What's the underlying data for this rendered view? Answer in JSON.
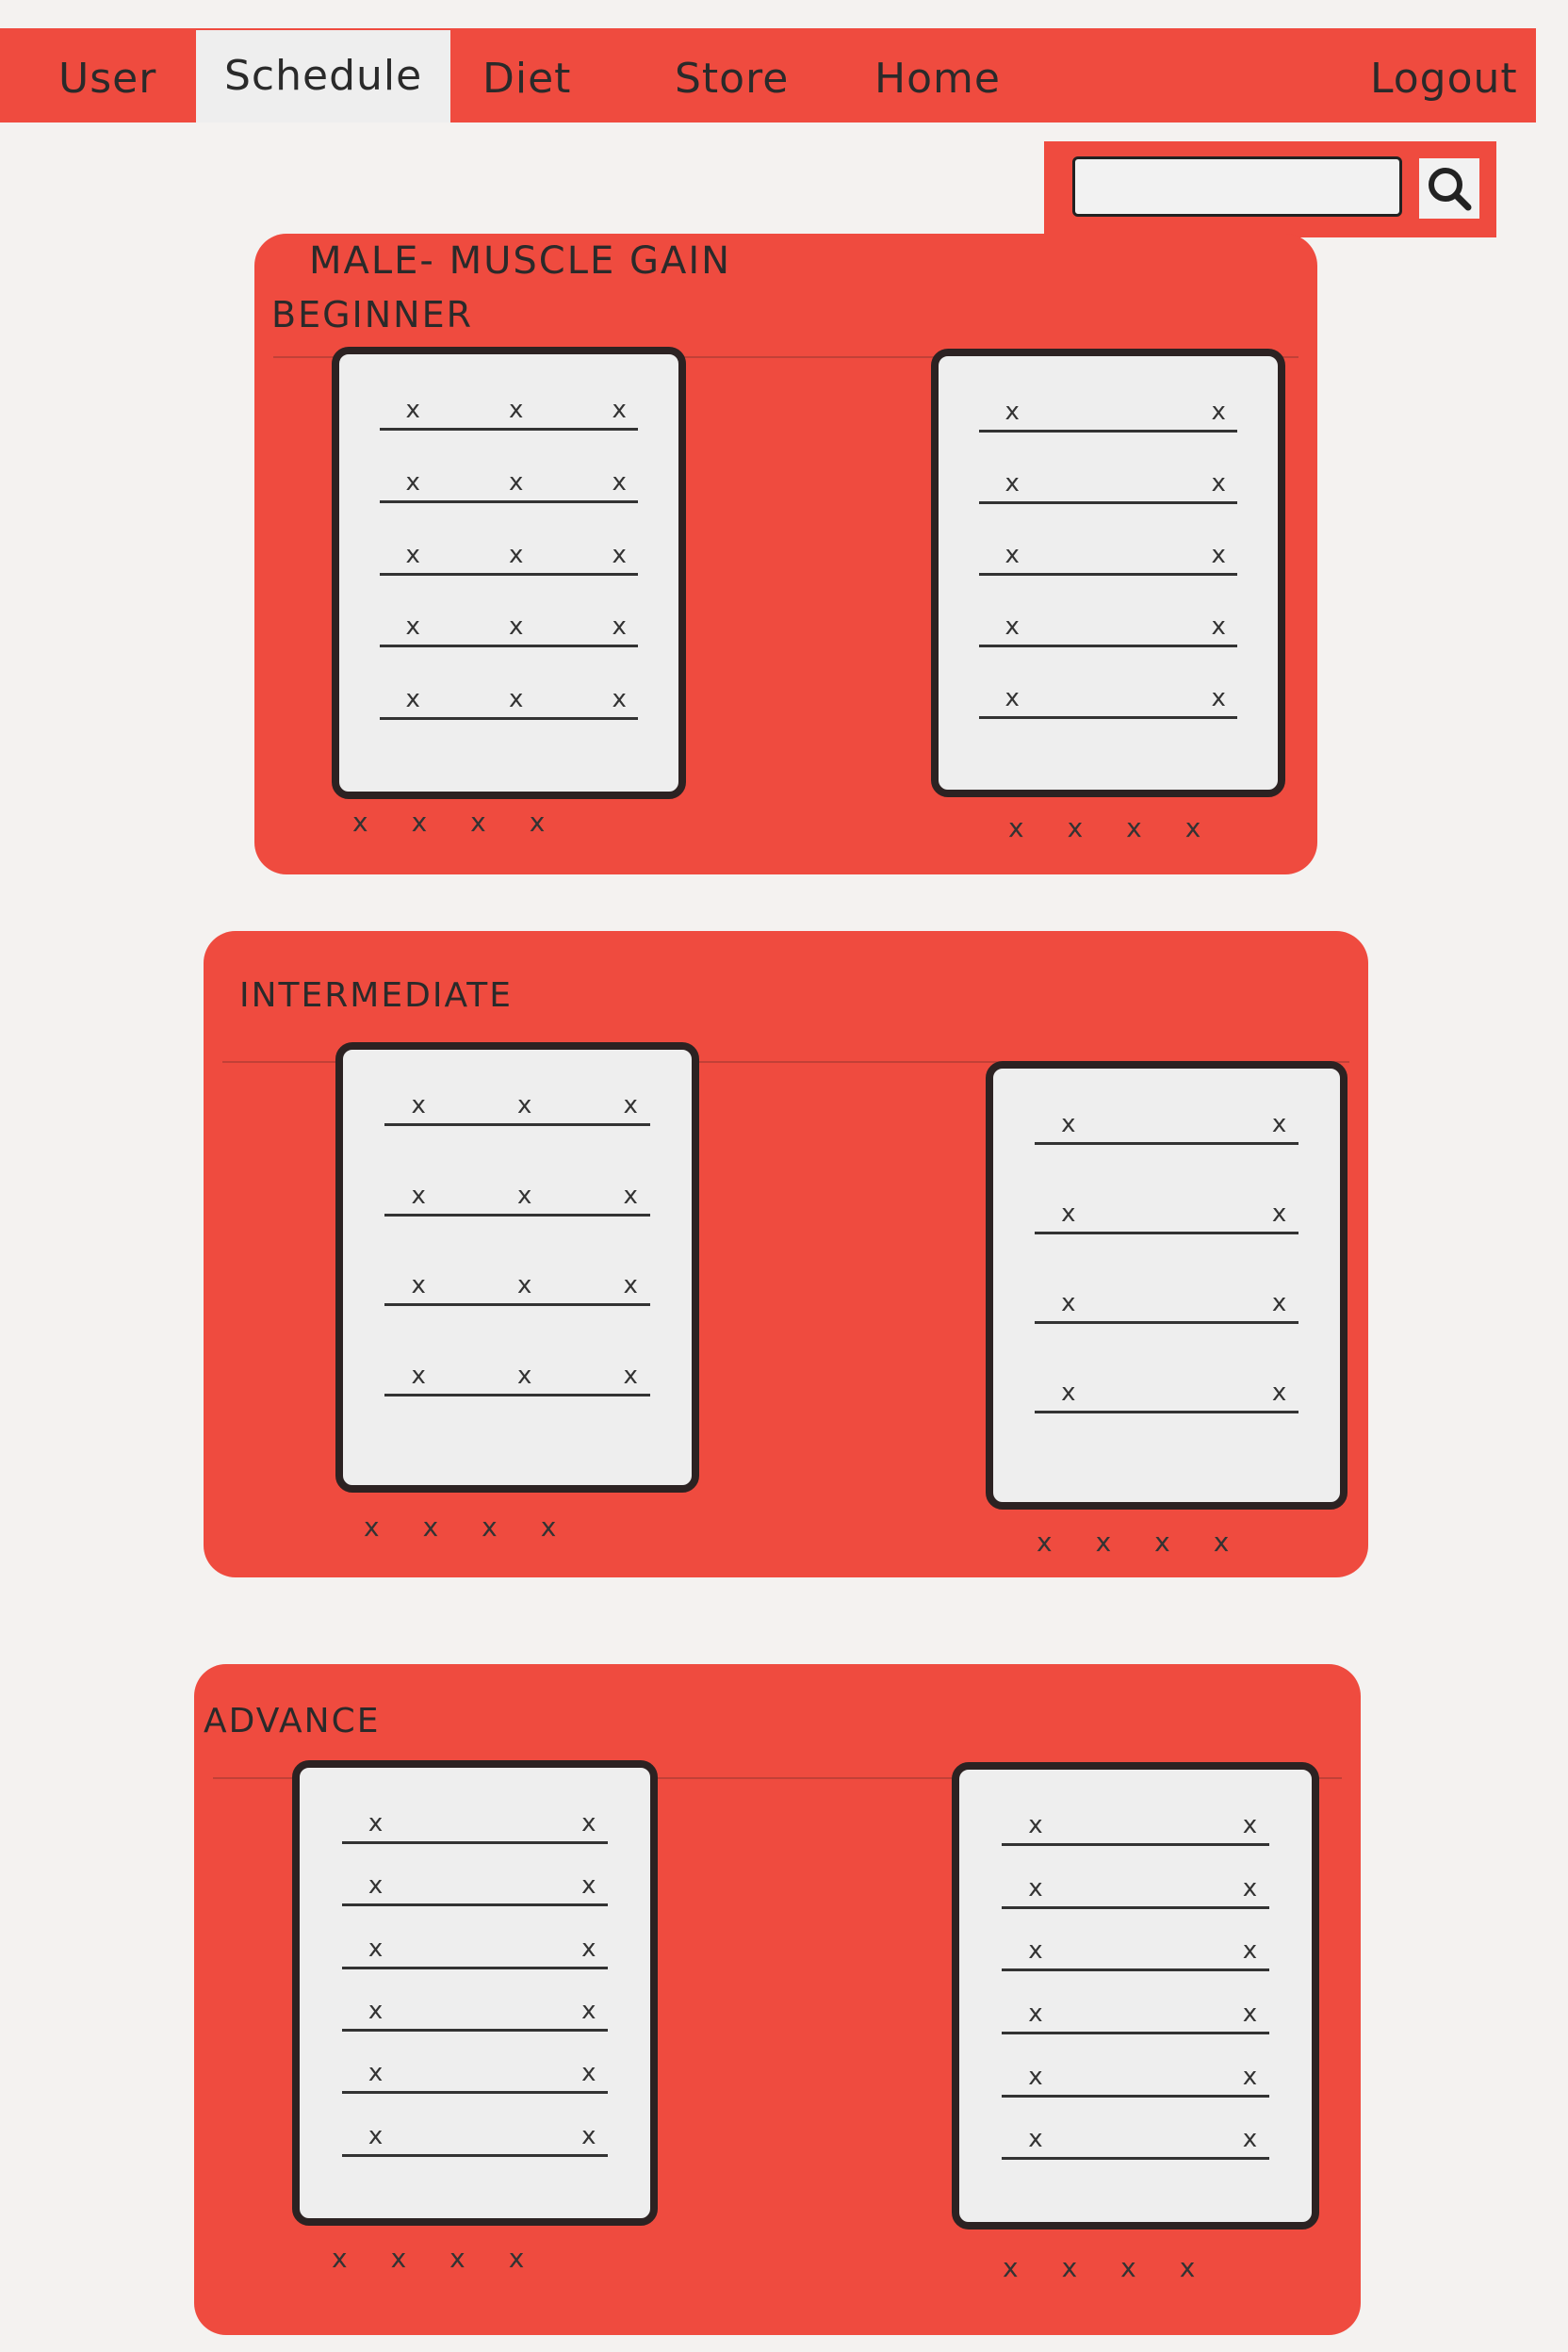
{
  "nav": {
    "items": [
      {
        "label": "User"
      },
      {
        "label": "Schedule",
        "active": true
      },
      {
        "label": "Diet"
      },
      {
        "label": "Store"
      },
      {
        "label": "Home"
      }
    ],
    "logout_label": "Logout"
  },
  "search": {
    "placeholder": "",
    "icon": "search-icon"
  },
  "page_title": "MALE- MUSCLE GAIN",
  "sections": [
    {
      "heading": "Beginner",
      "cards": [
        {
          "rows": [
            [
              "x",
              "x",
              "x"
            ],
            [
              "x",
              "x",
              "x"
            ],
            [
              "x",
              "x",
              "x"
            ],
            [
              "x",
              "x",
              "x"
            ],
            [
              "x",
              "x",
              "x"
            ]
          ],
          "footer": [
            "x",
            "x",
            "x",
            "x"
          ]
        },
        {
          "rows": [
            [
              "x",
              "x"
            ],
            [
              "x",
              "x"
            ],
            [
              "x",
              "x"
            ],
            [
              "x",
              "x"
            ],
            [
              "x",
              "x"
            ]
          ],
          "footer": [
            "x",
            "x",
            "x",
            "x"
          ]
        }
      ]
    },
    {
      "heading": "Intermediate",
      "cards": [
        {
          "rows": [
            [
              "x",
              "x",
              "x"
            ],
            [
              "x",
              "x",
              "x"
            ],
            [
              "x",
              "x",
              "x"
            ],
            [
              "x",
              "x",
              "x"
            ]
          ],
          "footer": [
            "x",
            "x",
            "x",
            "x"
          ]
        },
        {
          "rows": [
            [
              "x",
              "x"
            ],
            [
              "x",
              "x"
            ],
            [
              "x",
              "x"
            ],
            [
              "x",
              "x"
            ]
          ],
          "footer": [
            "x",
            "x",
            "x",
            "x"
          ]
        }
      ]
    },
    {
      "heading": "Advance",
      "cards": [
        {
          "rows": [
            [
              "x",
              "x"
            ],
            [
              "x",
              "x"
            ],
            [
              "x",
              "x"
            ],
            [
              "x",
              "x"
            ],
            [
              "x",
              "x"
            ],
            [
              "x",
              "x"
            ]
          ],
          "footer": [
            "x",
            "x",
            "x",
            "x"
          ]
        },
        {
          "rows": [
            [
              "x",
              "x"
            ],
            [
              "x",
              "x"
            ],
            [
              "x",
              "x"
            ],
            [
              "x",
              "x"
            ],
            [
              "x",
              "x"
            ],
            [
              "x",
              "x"
            ]
          ],
          "footer": [
            "x",
            "x",
            "x",
            "x"
          ]
        }
      ]
    }
  ],
  "colors": {
    "accent": "#ef4b3f",
    "paper": "#f4f2f0",
    "card": "#eeeeee",
    "ink": "#2c2222"
  }
}
